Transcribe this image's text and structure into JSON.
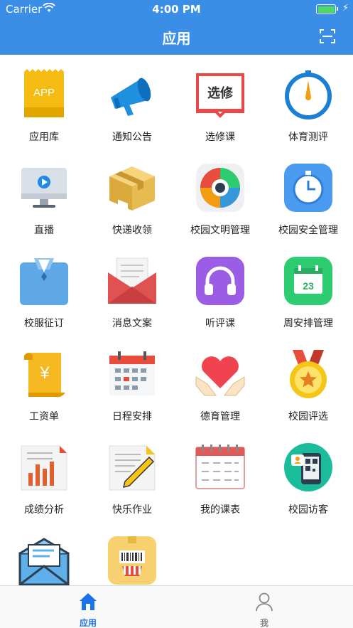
{
  "status_bar": {
    "carrier": "Carrier",
    "time": "4:00 PM",
    "battery_level": 1.0
  },
  "header": {
    "title": "应用"
  },
  "apps": [
    {
      "label": "应用库",
      "icon": "app-store-icon",
      "icon_text": "APP"
    },
    {
      "label": "通知公告",
      "icon": "megaphone-icon"
    },
    {
      "label": "选修课",
      "icon": "elective-book-icon",
      "icon_text": "选修"
    },
    {
      "label": "体育测评",
      "icon": "compass-gauge-icon"
    },
    {
      "label": "直播",
      "icon": "live-monitor-icon"
    },
    {
      "label": "快递收领",
      "icon": "parcel-box-icon"
    },
    {
      "label": "校园文明管理",
      "icon": "civility-wheel-icon"
    },
    {
      "label": "校园安全管理",
      "icon": "safety-clock-icon"
    },
    {
      "label": "校服征订",
      "icon": "uniform-shirt-icon"
    },
    {
      "label": "消息文案",
      "icon": "message-envelope-icon"
    },
    {
      "label": "听评课",
      "icon": "headphones-icon"
    },
    {
      "label": "周安排管理",
      "icon": "week-calendar-icon",
      "icon_text": "23"
    },
    {
      "label": "工资单",
      "icon": "salary-scroll-icon",
      "icon_text": "¥"
    },
    {
      "label": "日程安排",
      "icon": "schedule-calendar-icon"
    },
    {
      "label": "德育管理",
      "icon": "heart-hands-icon"
    },
    {
      "label": "校园评选",
      "icon": "medal-star-icon"
    },
    {
      "label": "成绩分析",
      "icon": "grade-chart-icon"
    },
    {
      "label": "快乐作业",
      "icon": "homework-pen-icon"
    },
    {
      "label": "我的课表",
      "icon": "timetable-icon"
    },
    {
      "label": "校园访客",
      "icon": "visitor-phone-icon"
    },
    {
      "label": "",
      "icon": "mail-open-icon"
    },
    {
      "label": "",
      "icon": "barcode-box-icon"
    }
  ],
  "tab_bar": {
    "tabs": [
      {
        "label": "应用",
        "icon": "home-icon",
        "active": true
      },
      {
        "label": "我",
        "icon": "person-icon",
        "active": false
      }
    ]
  },
  "colors": {
    "brand": "#3a8ee6",
    "active_tab": "#1a73e8",
    "inactive_tab": "#888888"
  }
}
